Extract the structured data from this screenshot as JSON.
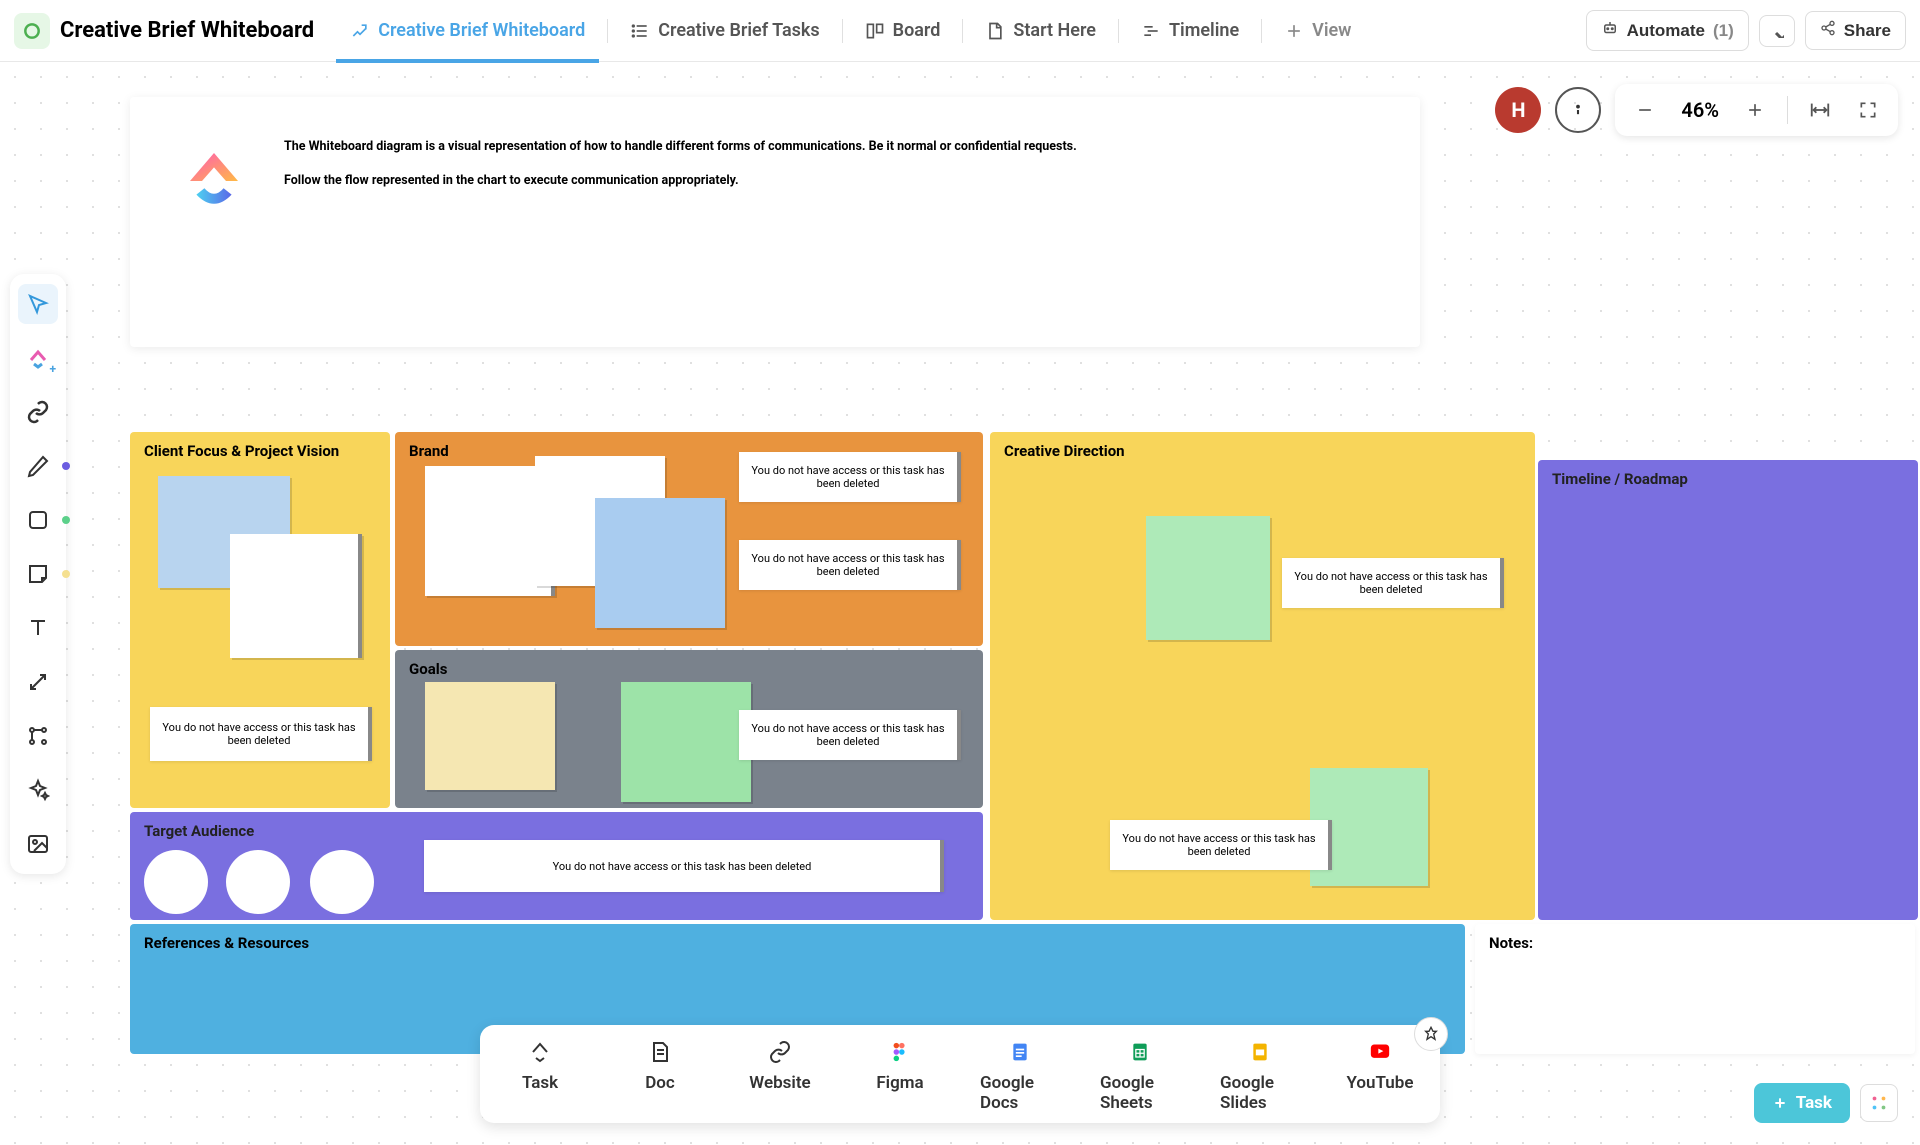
{
  "header": {
    "title": "Creative Brief Whiteboard",
    "tabs": [
      {
        "label": "Creative Brief Whiteboard",
        "icon": "whiteboard-icon",
        "active": true
      },
      {
        "label": "Creative Brief Tasks",
        "icon": "list-icon",
        "active": false
      },
      {
        "label": "Board",
        "icon": "board-icon",
        "active": false
      },
      {
        "label": "Start Here",
        "icon": "doc-icon",
        "active": false
      },
      {
        "label": "Timeline",
        "icon": "timeline-icon",
        "active": false
      },
      {
        "label": "View",
        "icon": "plus-icon",
        "active": false
      }
    ],
    "automate_label": "Automate",
    "automate_count": "(1)",
    "share_label": "Share"
  },
  "controls": {
    "avatar_letter": "H",
    "zoom_percent": "46%"
  },
  "wb_header": {
    "line1": "The Whiteboard diagram is a visual representation of how to handle different forms of communications. Be it normal or confidential requests.",
    "line2": "Follow the flow represented in the chart to execute communication appropriately."
  },
  "sections": {
    "client": "Client Focus & Project Vision",
    "brand": "Brand",
    "goals": "Goals",
    "target": "Target Audience",
    "creative": "Creative Direction",
    "timeline": "Timeline / Roadmap",
    "references": "References & Resources",
    "notes": "Notes:"
  },
  "task_card_text": "You do not have access or this task has been deleted",
  "dock": [
    {
      "label": "Task",
      "icon": "task-icon"
    },
    {
      "label": "Doc",
      "icon": "doc2-icon"
    },
    {
      "label": "Website",
      "icon": "link-icon"
    },
    {
      "label": "Figma",
      "icon": "figma-icon"
    },
    {
      "label": "Google Docs",
      "icon": "gdocs-icon"
    },
    {
      "label": "Google Sheets",
      "icon": "gsheets-icon"
    },
    {
      "label": "Google Slides",
      "icon": "gslides-icon"
    },
    {
      "label": "YouTube",
      "icon": "youtube-icon"
    }
  ],
  "bottom_task_button": "Task"
}
